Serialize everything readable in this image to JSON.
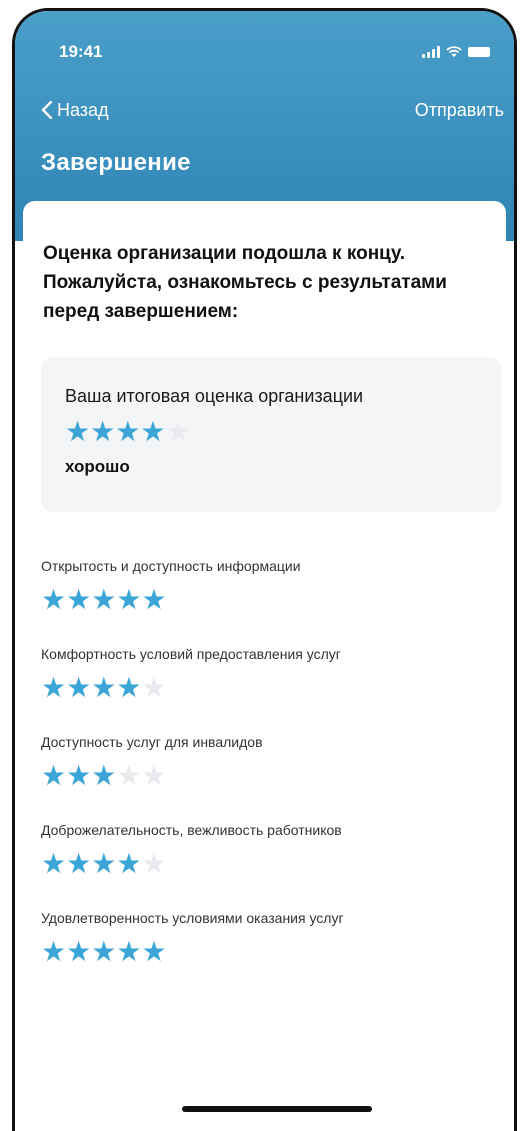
{
  "status": {
    "time": "19:41"
  },
  "nav": {
    "back_label": "Назад",
    "send_label": "Отправить"
  },
  "title": "Завершение",
  "intro": "Оценка организации подошла к концу. Пожалуйста, ознакомьтесь с результатами перед завершением:",
  "summary": {
    "label": "Ваша итоговая оценка организации",
    "rating": 4,
    "max": 5,
    "word": "хорошо"
  },
  "criteria": [
    {
      "label": "Открытость и доступность информации",
      "rating": 5
    },
    {
      "label": "Комфортность условий предоставления услуг",
      "rating": 4
    },
    {
      "label": "Доступность услуг для инвалидов",
      "rating": 3
    },
    {
      "label": "Доброжелательность, вежливость работников",
      "rating": 4
    },
    {
      "label": "Удовлетворенность условиями оказания услуг",
      "rating": 5
    }
  ],
  "colors": {
    "header_top": "#4a9fc9",
    "header_bottom": "#2f84b5",
    "star_on": "#3aa5d6",
    "star_off": "#e8eaee",
    "card_bg": "#f4f5f7"
  }
}
